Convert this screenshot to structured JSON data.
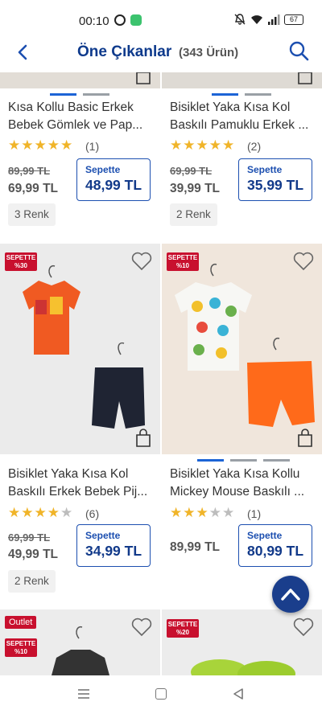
{
  "status_bar": {
    "time": "00:10",
    "battery": "67"
  },
  "header": {
    "title": "Öne Çıkanlar",
    "count": "(343 Ürün)"
  },
  "colors": {
    "brand": "#0e3a8c",
    "accent": "#1c64d6",
    "badge": "#c8102e",
    "star": "#f0b429"
  },
  "products": [
    {
      "name_line1": "Kısa Kollu Basic Erkek",
      "name_line2": "Bebek Gömlek ve Pap...",
      "rating": 5,
      "reviews": "(1)",
      "old_price": "89,99 TL",
      "price": "69,99 TL",
      "sepette_label": "Sepette",
      "sepette_price": "48,99 TL",
      "colors": "3 Renk",
      "sepette_badge": "",
      "outlet": ""
    },
    {
      "name_line1": "Bisiklet Yaka Kısa Kol",
      "name_line2": "Baskılı Pamuklu Erkek ...",
      "rating": 5,
      "reviews": "(2)",
      "old_price": "69,99 TL",
      "price": "39,99 TL",
      "sepette_label": "Sepette",
      "sepette_price": "35,99 TL",
      "colors": "2 Renk",
      "sepette_badge": "",
      "outlet": ""
    },
    {
      "name_line1": "Bisiklet Yaka Kısa Kol",
      "name_line2": "Baskılı Erkek Bebek Pij...",
      "rating": 4,
      "reviews": "(6)",
      "old_price": "69,99 TL",
      "price": "49,99 TL",
      "sepette_label": "Sepette",
      "sepette_price": "34,99 TL",
      "colors": "2 Renk",
      "sepette_badge": "SEPETTE %30",
      "outlet": ""
    },
    {
      "name_line1": "Bisiklet Yaka Kısa Kollu",
      "name_line2": "Mickey Mouse Baskılı ...",
      "rating": 3,
      "reviews": "(1)",
      "old_price": "",
      "price": "89,99 TL",
      "sepette_label": "Sepette",
      "sepette_price": "80,99 TL",
      "colors": "",
      "sepette_badge": "SEPETTE %10",
      "outlet": ""
    },
    {
      "sepette_badge": "SEPETTE %10",
      "outlet": "Outlet"
    },
    {
      "sepette_badge": "SEPETTE %20",
      "outlet": ""
    }
  ]
}
